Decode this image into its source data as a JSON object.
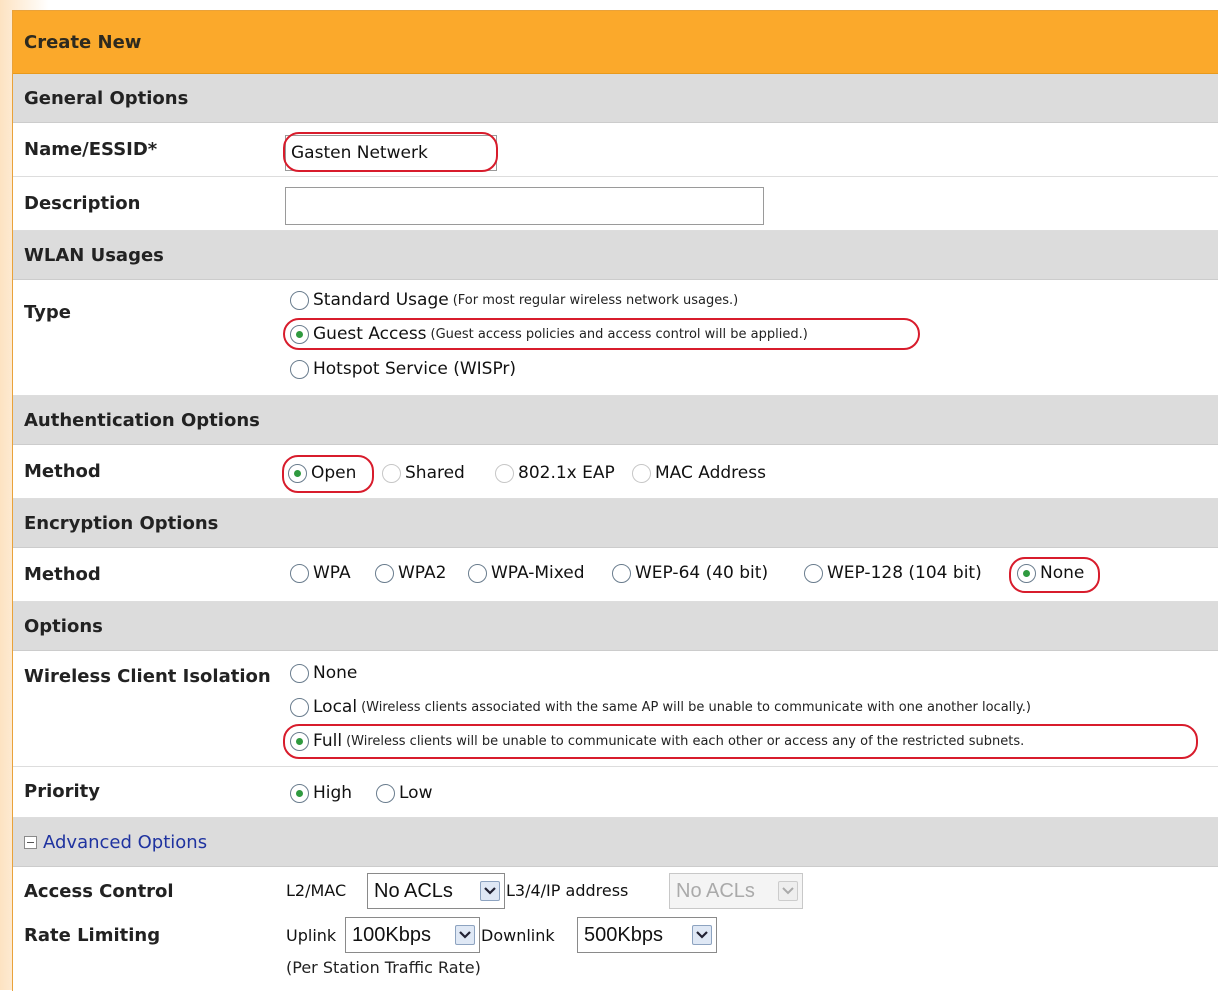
{
  "title": "Create New",
  "sections": {
    "general": "General Options",
    "wlan": "WLAN Usages",
    "auth": "Authentication Options",
    "encryption": "Encryption Options",
    "options": "Options",
    "advanced": "Advanced Options"
  },
  "name_field": {
    "label": "Name/ESSID*",
    "value": "Gasten Netwerk"
  },
  "description_field": {
    "label": "Description",
    "value": ""
  },
  "type": {
    "label": "Type",
    "options": [
      {
        "label": "Standard Usage",
        "note": "(For most regular wireless network usages.)",
        "checked": false
      },
      {
        "label": "Guest Access",
        "note": "(Guest access policies and access control will be applied.)",
        "checked": true
      },
      {
        "label": "Hotspot Service (WISPr)",
        "note": "",
        "checked": false
      }
    ]
  },
  "auth_method": {
    "label": "Method",
    "options": [
      {
        "label": "Open",
        "checked": true
      },
      {
        "label": "Shared",
        "checked": false
      },
      {
        "label": "802.1x EAP",
        "checked": false
      },
      {
        "label": "MAC Address",
        "checked": false
      }
    ]
  },
  "enc_method": {
    "label": "Method",
    "options": [
      {
        "label": "WPA",
        "checked": false
      },
      {
        "label": "WPA2",
        "checked": false
      },
      {
        "label": "WPA-Mixed",
        "checked": false
      },
      {
        "label": "WEP-64 (40 bit)",
        "checked": false
      },
      {
        "label": "WEP-128 (104 bit)",
        "checked": false
      },
      {
        "label": "None",
        "checked": true
      }
    ]
  },
  "isolation": {
    "label": "Wireless Client Isolation",
    "options": [
      {
        "label": "None",
        "note": "",
        "checked": false
      },
      {
        "label": "Local",
        "note": "(Wireless clients associated with the same AP will be unable to communicate with one another locally.)",
        "checked": false
      },
      {
        "label": "Full",
        "note": "(Wireless clients will be unable to communicate with each other or access any of the restricted subnets.",
        "checked": true
      }
    ]
  },
  "priority": {
    "label": "Priority",
    "options": [
      {
        "label": "High",
        "checked": true
      },
      {
        "label": "Low",
        "checked": false
      }
    ]
  },
  "access_control": {
    "label": "Access Control",
    "l2_label": "L2/MAC",
    "l2_value": "No ACLs",
    "l3_label": "L3/4/IP address",
    "l3_value": "No ACLs"
  },
  "rate_limiting": {
    "label": "Rate Limiting",
    "uplink_label": "Uplink",
    "uplink_value": "100Kbps",
    "downlink_label": "Downlink",
    "downlink_value": "500Kbps",
    "note": "(Per Station Traffic Rate)"
  },
  "colors": {
    "header": "#fba92b",
    "section": "#dcdcdc",
    "highlight": "#d81c2c",
    "link": "#1f33a0"
  }
}
